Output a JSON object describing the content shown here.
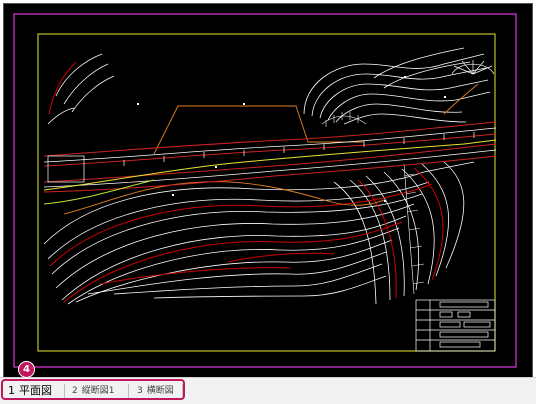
{
  "tabs": [
    {
      "num": "1",
      "label": "平面図",
      "active": true
    },
    {
      "num": "2",
      "label": "縦断図1",
      "active": false
    },
    {
      "num": "3",
      "label": "横断図",
      "active": false
    }
  ],
  "callout": {
    "label": "4"
  },
  "colors": {
    "background": "#000000",
    "paper_border": "#cc33cc",
    "frame": "#e6e633",
    "contour": "#ffffff",
    "index_contour": "#cc0000",
    "road_line": "#cc2222",
    "guide_line": "#e08020",
    "centerline": "#e6e633",
    "highlight": "#c2185b"
  }
}
